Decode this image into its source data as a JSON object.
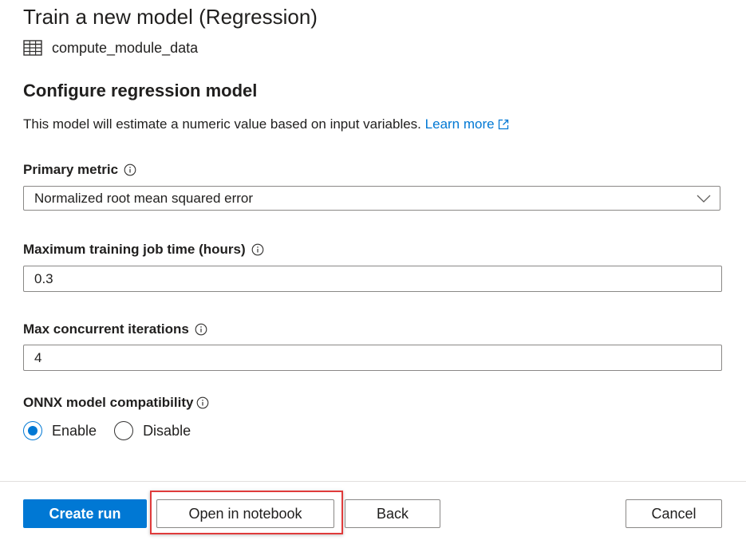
{
  "header": {
    "title": "Train a new model (Regression)",
    "dataset_icon": "table-grid-icon",
    "dataset_name": "compute_module_data"
  },
  "section": {
    "title": "Configure regression model",
    "description": "This model will estimate a numeric value based on input variables.",
    "learn_more": "Learn more",
    "learn_more_icon": "external-link-icon"
  },
  "fields": {
    "primary_metric": {
      "label": "Primary metric",
      "info_icon": "info-icon",
      "value": "Normalized root mean squared error"
    },
    "max_training_time": {
      "label": "Maximum training job time (hours)",
      "info_icon": "info-icon",
      "value": "0.3"
    },
    "max_concurrent": {
      "label": "Max concurrent iterations",
      "info_icon": "info-icon",
      "value": "4"
    },
    "onnx": {
      "label": "ONNX model compatibility",
      "info_icon": "info-icon",
      "options": [
        {
          "label": "Enable",
          "checked": true
        },
        {
          "label": "Disable",
          "checked": false
        }
      ]
    }
  },
  "footer": {
    "create_run": "Create run",
    "open_notebook": "Open in notebook",
    "back": "Back",
    "cancel": "Cancel"
  },
  "colors": {
    "accent": "#0078d4",
    "highlight_border": "#e03b3b",
    "text": "#201f1e",
    "border": "#8a8886"
  }
}
